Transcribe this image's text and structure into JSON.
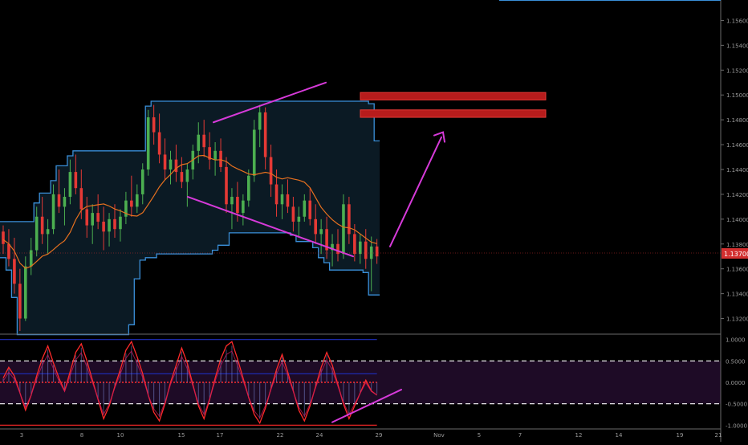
{
  "colors": {
    "background": "#000000",
    "up_candle": "#4caf50",
    "down_candle": "#e53935",
    "channel_band": "#3a8fd9",
    "channel_fill": "#0b1a24",
    "midline": "#e8711f",
    "trendline": "#d63ad9",
    "resistance_zone": "#b71c1c",
    "price_badge": "#d32f2f",
    "osc_fill": "#1e0b26",
    "osc_line": "#ff2a2a",
    "osc_level_upper": "#1f2fbf",
    "axis_text": "#9a9a9a",
    "divider": "#6a6a6a"
  },
  "price_axis": {
    "ticks": [
      "1.15600",
      "1.15400",
      "1.15200",
      "1.15000",
      "1.14800",
      "1.14600",
      "1.14400",
      "1.14200",
      "1.14000",
      "1.13800",
      "1.13600",
      "1.13400",
      "1.13200"
    ],
    "current_price": "1.13700"
  },
  "osc_axis": {
    "ticks": [
      "1.0000",
      "0.5000",
      "0.0000",
      "-0.5000",
      "-1.0000"
    ]
  },
  "time_axis": {
    "labels": [
      "3",
      "8",
      "10",
      "15",
      "17",
      "22",
      "24",
      "29",
      "Nov",
      "5",
      "7",
      "12",
      "14",
      "19",
      "21"
    ]
  },
  "chart_data": [
    {
      "type": "candlestick",
      "ylim": [
        1.131,
        1.157
      ],
      "ohlc": [
        [
          1.139,
          1.1395,
          1.1372,
          1.138
        ],
        [
          1.138,
          1.1392,
          1.1362,
          1.1368
        ],
        [
          1.1368,
          1.1385,
          1.134,
          1.1348
        ],
        [
          1.1348,
          1.136,
          1.131,
          1.132
        ],
        [
          1.132,
          1.137,
          1.1318,
          1.1362
        ],
        [
          1.1362,
          1.1385,
          1.1355,
          1.1375
        ],
        [
          1.1375,
          1.141,
          1.137,
          1.1402
        ],
        [
          1.1402,
          1.1418,
          1.138,
          1.1388
        ],
        [
          1.1388,
          1.14,
          1.1372,
          1.1392
        ],
        [
          1.1392,
          1.1428,
          1.1388,
          1.142
        ],
        [
          1.142,
          1.144,
          1.1405,
          1.141
        ],
        [
          1.141,
          1.1425,
          1.1395,
          1.1418
        ],
        [
          1.1418,
          1.1448,
          1.1412,
          1.1438
        ],
        [
          1.1438,
          1.1452,
          1.142,
          1.1425
        ],
        [
          1.1425,
          1.144,
          1.14,
          1.1408
        ],
        [
          1.1408,
          1.1418,
          1.1385,
          1.1395
        ],
        [
          1.1395,
          1.1412,
          1.138,
          1.1405
        ],
        [
          1.1405,
          1.142,
          1.1392,
          1.1398
        ],
        [
          1.1398,
          1.141,
          1.1375,
          1.139
        ],
        [
          1.139,
          1.1405,
          1.1378,
          1.14
        ],
        [
          1.14,
          1.1412,
          1.1385,
          1.1392
        ],
        [
          1.1392,
          1.1408,
          1.1382,
          1.1402
        ],
        [
          1.1402,
          1.1422,
          1.1396,
          1.1415
        ],
        [
          1.1415,
          1.1435,
          1.1402,
          1.141
        ],
        [
          1.141,
          1.1428,
          1.1405,
          1.142
        ],
        [
          1.142,
          1.1445,
          1.1412,
          1.144
        ],
        [
          1.144,
          1.1488,
          1.1435,
          1.1482
        ],
        [
          1.1482,
          1.1492,
          1.146,
          1.147
        ],
        [
          1.147,
          1.1485,
          1.1445,
          1.1452
        ],
        [
          1.1452,
          1.1465,
          1.1432,
          1.144
        ],
        [
          1.144,
          1.1455,
          1.1428,
          1.1448
        ],
        [
          1.1448,
          1.146,
          1.143,
          1.1438
        ],
        [
          1.1438,
          1.145,
          1.1425,
          1.143
        ],
        [
          1.143,
          1.1445,
          1.141,
          1.144
        ],
        [
          1.144,
          1.146,
          1.1432,
          1.1455
        ],
        [
          1.1455,
          1.1478,
          1.1445,
          1.1468
        ],
        [
          1.1468,
          1.148,
          1.145,
          1.1458
        ],
        [
          1.1458,
          1.147,
          1.144,
          1.1448
        ],
        [
          1.1448,
          1.1462,
          1.1435,
          1.1455
        ],
        [
          1.1455,
          1.1465,
          1.1438,
          1.1442
        ],
        [
          1.1442,
          1.145,
          1.1405,
          1.1412
        ],
        [
          1.1412,
          1.1425,
          1.1392,
          1.1418
        ],
        [
          1.1418,
          1.143,
          1.1398,
          1.1405
        ],
        [
          1.1405,
          1.142,
          1.1395,
          1.1415
        ],
        [
          1.1415,
          1.144,
          1.141,
          1.1435
        ],
        [
          1.1435,
          1.148,
          1.143,
          1.1472
        ],
        [
          1.1472,
          1.1492,
          1.1458,
          1.1486
        ],
        [
          1.1486,
          1.149,
          1.144,
          1.145
        ],
        [
          1.145,
          1.146,
          1.1418,
          1.1428
        ],
        [
          1.1428,
          1.144,
          1.1402,
          1.1412
        ],
        [
          1.1412,
          1.1428,
          1.14,
          1.142
        ],
        [
          1.142,
          1.1432,
          1.1405,
          1.141
        ],
        [
          1.141,
          1.1418,
          1.139,
          1.1398
        ],
        [
          1.1398,
          1.141,
          1.1385,
          1.1402
        ],
        [
          1.1402,
          1.142,
          1.1398,
          1.1415
        ],
        [
          1.1415,
          1.1425,
          1.1395,
          1.14
        ],
        [
          1.14,
          1.1412,
          1.138,
          1.1388
        ],
        [
          1.1388,
          1.14,
          1.1372,
          1.1392
        ],
        [
          1.1392,
          1.1402,
          1.1368,
          1.1375
        ],
        [
          1.1375,
          1.1388,
          1.1362,
          1.138
        ],
        [
          1.138,
          1.1392,
          1.1366,
          1.1372
        ],
        [
          1.1372,
          1.142,
          1.1368,
          1.1412
        ],
        [
          1.1412,
          1.1418,
          1.138,
          1.1388
        ],
        [
          1.1388,
          1.1396,
          1.1366,
          1.1372
        ],
        [
          1.1372,
          1.1388,
          1.1364,
          1.1382
        ],
        [
          1.1382,
          1.1392,
          1.136,
          1.1368
        ],
        [
          1.1368,
          1.1386,
          1.1342,
          1.1378
        ],
        [
          1.1378,
          1.1384,
          1.1364,
          1.137
        ]
      ]
    },
    {
      "type": "line",
      "ylim": [
        -1.05,
        1.05
      ],
      "levels": [
        1.0,
        0.5,
        0.0,
        -0.5,
        -1.0
      ],
      "values": [
        0.1,
        0.35,
        0.15,
        -0.25,
        -0.65,
        -0.3,
        0.15,
        0.55,
        0.85,
        0.45,
        0.1,
        -0.2,
        0.25,
        0.7,
        0.9,
        0.5,
        0.05,
        -0.4,
        -0.85,
        -0.55,
        -0.1,
        0.3,
        0.75,
        0.95,
        0.6,
        0.2,
        -0.3,
        -0.7,
        -0.9,
        -0.5,
        0.0,
        0.4,
        0.8,
        0.45,
        -0.05,
        -0.55,
        -0.85,
        -0.4,
        0.1,
        0.55,
        0.85,
        0.95,
        0.55,
        0.1,
        -0.35,
        -0.75,
        -0.95,
        -0.6,
        -0.15,
        0.3,
        0.65,
        0.25,
        -0.2,
        -0.65,
        -0.9,
        -0.55,
        -0.1,
        0.35,
        0.7,
        0.4,
        -0.05,
        -0.5,
        -0.85,
        -0.55,
        -0.25,
        0.05,
        -0.2,
        -0.3
      ]
    }
  ]
}
